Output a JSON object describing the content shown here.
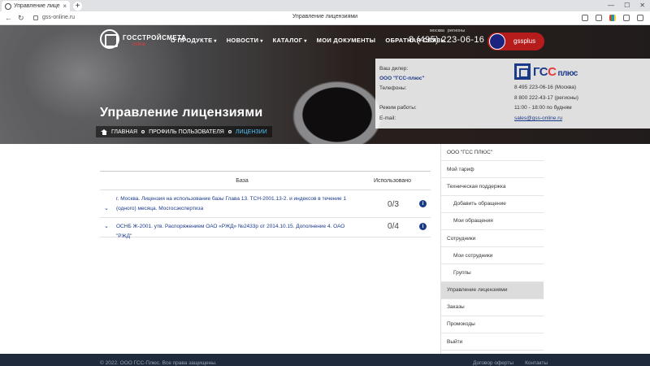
{
  "browser": {
    "tab_title": "Управление лицензия",
    "window_title": "Управление лицензиями",
    "url": "gss-online.ru"
  },
  "header": {
    "logo_name": "ГОССТРОЙСМЕТА",
    "logo_sub": "online",
    "menu": [
      {
        "label": "О ПРОДУКТЕ",
        "chevron": "chevron-down-icon"
      },
      {
        "label": "НОВОСТИ",
        "chevron": "chevron-down-icon"
      },
      {
        "label": "КАТАЛОГ",
        "chevron": "chevron-down-icon"
      },
      {
        "label": "МОИ ДОКУМЕНТЫ"
      },
      {
        "label": "ОБРАТНАЯ СВЯЗЬ"
      }
    ],
    "phone_label_1": "москва",
    "phone_label_2": "регионы",
    "phone": "8 (495) 223-06-16",
    "username": "gssplus"
  },
  "hero": {
    "title": "Управление лицензиями",
    "breadcrumbs": [
      "ГЛАВНАЯ",
      "ПРОФИЛЬ ПОЛЬЗОВАТЕЛЯ",
      "ЛИЦЕНЗИИ"
    ]
  },
  "dealer": {
    "label": "Ваш дилер:",
    "company": "ООО \"ГСС-плюс\"",
    "phones_label": "Телефоны:",
    "phone_moscow": "8 495 223-06-16 (Москва)",
    "phone_regions": "8 800 222-43-17 (регионы)",
    "hours_label": "Режим работы:",
    "hours": "11:00 - 18:00 по будням",
    "email_label": "E-mail:",
    "email": "sales@gss-online.ru",
    "logo_text_1": "ГС",
    "logo_text_2": "С",
    "logo_text_3": "плюс"
  },
  "table": {
    "headers": {
      "base": "База",
      "used": "Использовано"
    },
    "rows": [
      {
        "name_line1": "г. Москва. Лицензия на использование базы Глава 13. ТСН-2001.13-2. и индексов в течение 1",
        "name_line2": "(одного) месяца. Мосгосэкспертиза",
        "used": "0/3"
      },
      {
        "name_line1": "ОСНБ Ж-2001. утв. Распоряжением ОАО «РЖД» №2433р от 2014.10.15. Дополнение 4. ОАО \"РЖД\"",
        "used": "0/4"
      }
    ]
  },
  "sidebar": {
    "items": [
      {
        "label": "ООО \"ГСС ПЛЮС\""
      },
      {
        "label": "Мой тариф"
      },
      {
        "label": "Техническая поддержка"
      },
      {
        "label": "Добавить обращение"
      },
      {
        "label": "Мои обращения"
      },
      {
        "label": "Сотрудники"
      },
      {
        "label": "Мои сотрудники"
      },
      {
        "label": "Группы"
      },
      {
        "label": "Управление лицензиями"
      },
      {
        "label": "Заказы"
      },
      {
        "label": "Промокоды"
      },
      {
        "label": "Выйти"
      }
    ]
  },
  "footer": {
    "copyright": "© 2022. ООО ГСС-Плюс. Все права защищены.",
    "links": [
      "Договор оферты",
      "Контакты"
    ]
  }
}
